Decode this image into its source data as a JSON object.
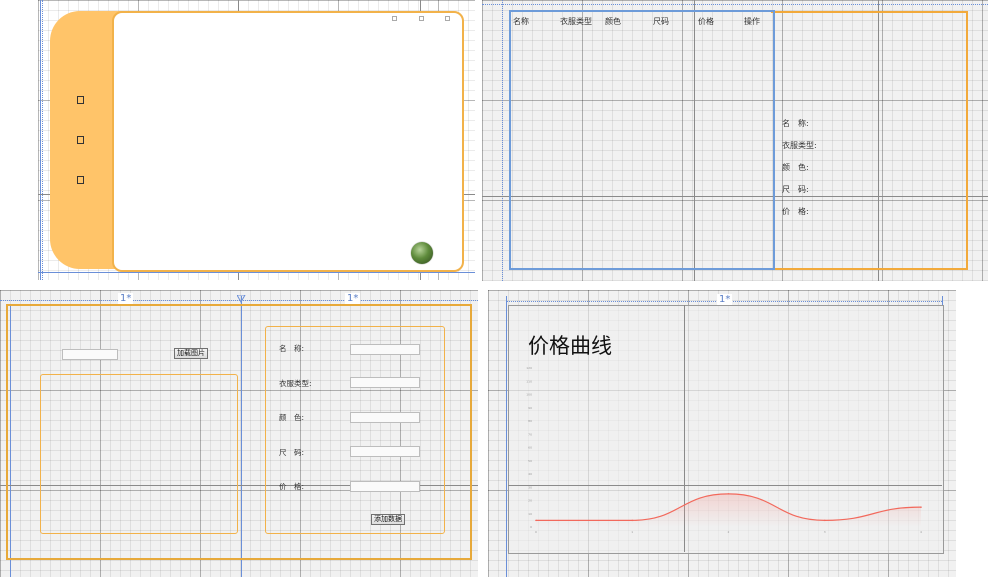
{
  "panel1": {
    "side_icons": [
      "icon-box",
      "icon-box",
      "icon-box"
    ],
    "window_controls": [
      "minimize-icon",
      "maximize-icon",
      "close-icon"
    ],
    "colors": {
      "sidebar": "#ffc469",
      "border": "#f2b24a"
    }
  },
  "panel2": {
    "table_headers": [
      "名称",
      "衣服类型",
      "颜色",
      "尺码",
      "价格",
      "操作"
    ],
    "detail_labels": [
      "名　称:",
      "衣服类型:",
      "颜　色:",
      "尺　码:",
      "价　格:"
    ],
    "colors": {
      "table_border": "#6d9bd9",
      "detail_border": "#f2a93a"
    }
  },
  "panel3": {
    "column_markers": [
      "1*",
      "1*"
    ],
    "load_image_button": "加载图片",
    "form_labels": [
      "名　称:",
      "衣服类型:",
      "颜　色:",
      "尺　码:",
      "价　格:"
    ],
    "add_data_button": "添加数据"
  },
  "panel4": {
    "column_marker": "1*",
    "title": "价格曲线",
    "chart_data": {
      "type": "area",
      "title": "价格曲线",
      "x": [
        0,
        1,
        2,
        3,
        4
      ],
      "y": [
        5,
        5,
        25,
        5,
        15
      ],
      "ylim": [
        0,
        120
      ],
      "y_ticks": [
        0,
        10,
        20,
        30,
        40,
        50,
        60,
        70,
        80,
        90,
        100,
        110,
        120
      ],
      "grid": true,
      "line_color": "#f2695c"
    }
  }
}
